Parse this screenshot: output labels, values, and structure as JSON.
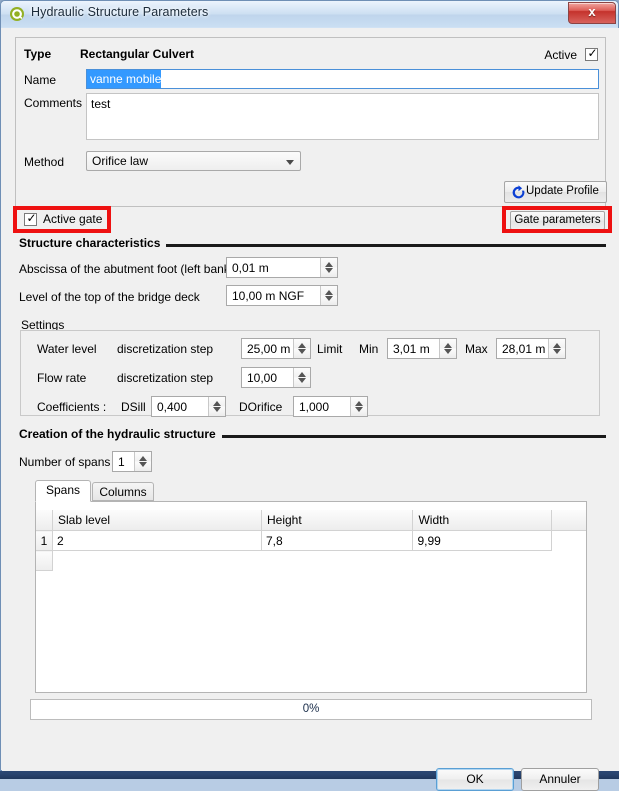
{
  "window": {
    "title": "Hydraulic Structure Parameters",
    "icon": "qgis-logo-icon",
    "close_label": "x"
  },
  "form": {
    "type_label": "Type",
    "type_value": "Rectangular Culvert",
    "active_label": "Active",
    "active_checked": true,
    "name_label": "Name",
    "name_value": "vanne mobile",
    "comments_label": "Comments",
    "comments_value": "test",
    "method_label": "Method",
    "method_value": "Orifice law",
    "update_profile_label": "Update Profile",
    "gate_parameters_label": "Gate parameters",
    "active_gate_label_a": "Active ",
    "active_gate_label_u": "g",
    "active_gate_label_b": "ate",
    "active_gate_checked": true
  },
  "structure": {
    "group_title": "Structure characteristics",
    "abscissa_label": "Abscissa of the abutment foot (left bank)",
    "abscissa_value": "0,01 m",
    "bridge_deck_label": "Level of the top of the bridge deck",
    "bridge_deck_value": "10,00 m NGF"
  },
  "settings": {
    "label": "Settings",
    "water_level_label": "Water level",
    "water_level_step_label": "discretization step",
    "water_level_step_value": "25,00 m",
    "limit_label": "Limit",
    "min_label": "Min",
    "min_value": "3,01 m",
    "max_label": "Max",
    "max_value": "28,01 m",
    "flow_rate_label": "Flow rate",
    "flow_rate_step_label": "discretization step",
    "flow_rate_step_value": "10,00",
    "coefficients_label": "Coefficients :",
    "dsill_label": "DSill",
    "dsill_value": "0,400",
    "dorifice_label": "DOrifice",
    "dorifice_value": "1,000"
  },
  "creation": {
    "group_title": "Creation of the hydraulic structure",
    "spans_label": "Number of spans",
    "spans_value": "1",
    "tabs": [
      {
        "label": "Spans",
        "selected": true
      },
      {
        "label": "Columns",
        "selected": false
      }
    ],
    "table": {
      "columns": [
        "Slab level",
        "Height",
        "Width"
      ],
      "rows": [
        {
          "index": "1",
          "cells": [
            "2",
            "7,8",
            "9,99"
          ]
        }
      ]
    }
  },
  "progress": {
    "text": "0%",
    "percent": 0
  },
  "buttons": {
    "ok_label": "OK",
    "cancel_label": "Annuler"
  },
  "annotations": {
    "highlight_color": "#ee1111",
    "boxes": [
      "active-gate-checkbox",
      "gate-parameters-button"
    ]
  }
}
